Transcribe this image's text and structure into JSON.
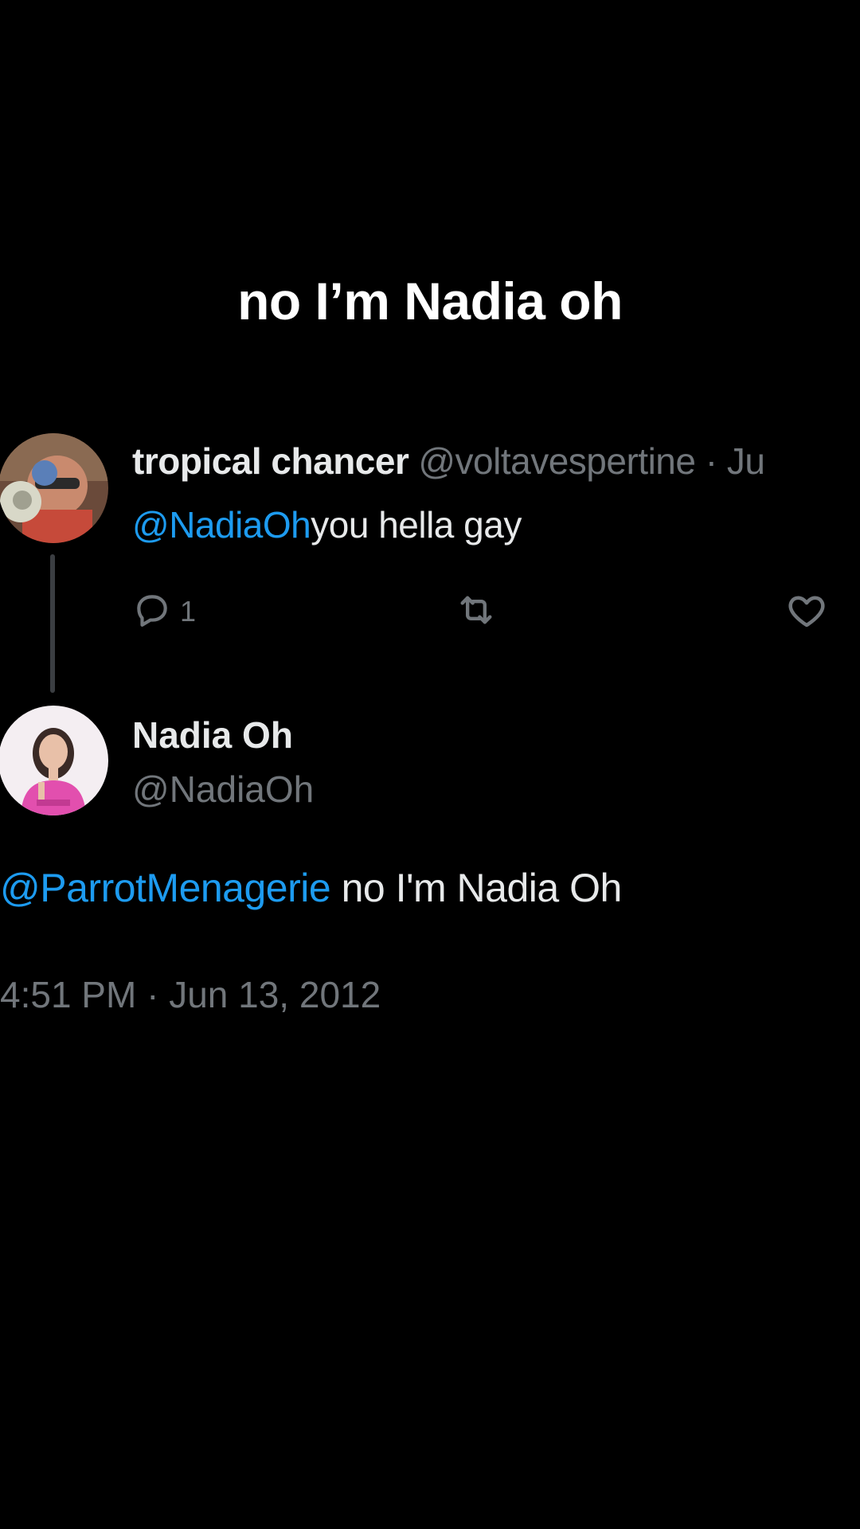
{
  "caption": "no I’m Nadia oh",
  "reply_tweet": {
    "display_name": "tropical chancer",
    "handle_meta": "@voltavespertine · Ju",
    "mention": "@NadiaOh",
    "text": "you hella gay",
    "reply_count": "1",
    "avatar_icon": "avatar-photo"
  },
  "actions": {
    "reply_icon": "comment-icon",
    "retweet_icon": "retweet-icon",
    "like_icon": "heart-icon"
  },
  "main_tweet": {
    "display_name": "Nadia Oh",
    "handle": "@NadiaOh",
    "mention": "@ParrotMenagerie",
    "text": " no I'm Nadia Oh",
    "timestamp": "4:51 PM · Jun 13, 2012",
    "avatar_icon": "avatar-photo"
  },
  "colors": {
    "background": "#000000",
    "text_primary": "#e7e9ea",
    "text_secondary": "#71767b",
    "link": "#1d9bf0"
  }
}
